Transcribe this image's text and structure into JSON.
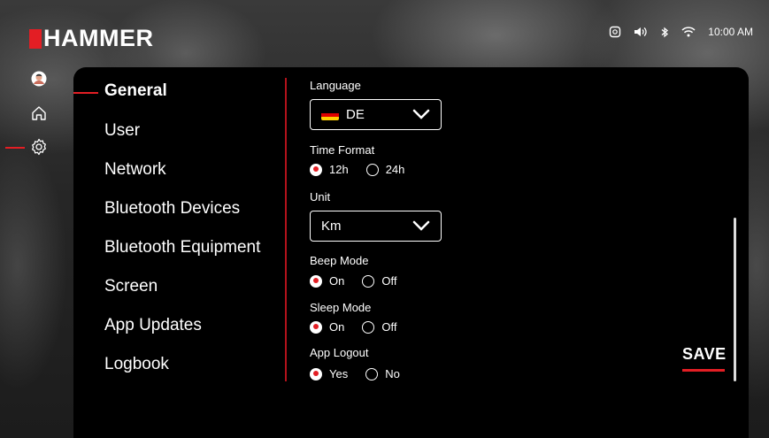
{
  "brand": {
    "logo_text": "HAMMER",
    "accent": "#e31e24"
  },
  "status_bar": {
    "time": "10:00 AM",
    "icons": [
      "nfc-icon",
      "volume-icon",
      "bluetooth-icon",
      "wifi-icon"
    ]
  },
  "left_nav": {
    "items": [
      "profile-icon",
      "home-icon",
      "settings-icon"
    ],
    "active": "settings-icon"
  },
  "menu": {
    "active": "General",
    "items": [
      "General",
      "User",
      "Network",
      "Bluetooth Devices",
      "Bluetooth Equipment",
      "Screen",
      "App Updates",
      "Logbook"
    ]
  },
  "form": {
    "language": {
      "label": "Language",
      "value": "DE"
    },
    "time_format": {
      "label": "Time Format",
      "options": [
        "12h",
        "24h"
      ],
      "selected": "12h"
    },
    "unit": {
      "label": "Unit",
      "value": "Km"
    },
    "beep_mode": {
      "label": "Beep Mode",
      "options": [
        "On",
        "Off"
      ],
      "selected": "On"
    },
    "sleep_mode": {
      "label": "Sleep Mode",
      "options": [
        "On",
        "Off"
      ],
      "selected": "On"
    },
    "app_logout": {
      "label": "App Logout",
      "options": [
        "Yes",
        "No"
      ],
      "selected": "Yes"
    }
  },
  "save_label": "SAVE"
}
